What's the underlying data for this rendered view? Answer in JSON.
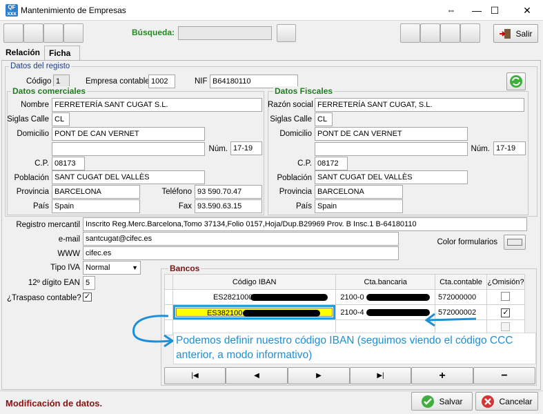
{
  "window": {
    "title": "Mantenimiento de Empresas",
    "minimize": "—",
    "maximize": "☐",
    "close": "✕",
    "restore": "⇔"
  },
  "toolbar": {
    "search_label": "Búsqueda:",
    "search_value": "",
    "exit_label": "Salir"
  },
  "tabs": [
    {
      "label": "Relación"
    },
    {
      "label": "Ficha"
    }
  ],
  "registro": {
    "legend": "Datos del registo",
    "codigo_label": "Código",
    "codigo": "1",
    "empresa_label": "Empresa contable",
    "empresa": "1002",
    "nif_label": "NIF",
    "nif": "B64180110"
  },
  "comerciales": {
    "title": "Datos comerciales",
    "nombre_label": "Nombre",
    "nombre": "FERRETERÍA SANT CUGAT S.L.",
    "siglas_label": "Siglas Calle",
    "siglas": "CL",
    "domicilio_label": "Domicilio",
    "domicilio": "PONT DE CAN VERNET",
    "domicilio2": "",
    "num_label": "Núm.",
    "num": "17-19",
    "cp_label": "C.P.",
    "cp": "08173",
    "poblacion_label": "Población",
    "poblacion": "SANT CUGAT DEL VALLÈS",
    "provincia_label": "Provincia",
    "provincia": "BARCELONA",
    "telefono_label": "Teléfono",
    "telefono": "93 590.70.47",
    "pais_label": "País",
    "pais": "Spain",
    "fax_label": "Fax",
    "fax": "93.590.63.15"
  },
  "fiscales": {
    "title": "Datos Fiscales",
    "razon_label": "Razón social",
    "razon": "FERRETERÍA SANT CUGAT, S.L.",
    "siglas_label": "Siglas Calle",
    "siglas": "CL",
    "domicilio_label": "Domicilio",
    "domicilio": "PONT DE CAN VERNET",
    "domicilio2": "",
    "num_label": "Núm.",
    "num": "17-19",
    "cp_label": "C.P.",
    "cp": "08172",
    "poblacion_label": "Población",
    "poblacion": "SANT CUGAT DEL VALLÈS",
    "provincia_label": "Provincia",
    "provincia": "BARCELONA",
    "pais_label": "País",
    "pais": "Spain"
  },
  "extra": {
    "registro_label": "Registro mercantil",
    "registro": "Inscrito Reg.Merc.Barcelona,Tomo 37134,Folio 0157,Hoja/Dup.B29969 Prov. B Insc.1 B-64180110",
    "email_label": "e-mail",
    "email": "santcugat@cifec.es",
    "www_label": "WWW",
    "www": "cifec.es",
    "color_label": "Color formularios",
    "iva_label": "Tipo IVA",
    "iva": "Normal",
    "ean_label": "12º dígito EAN",
    "ean": "5",
    "traspaso_label": "¿Traspaso contable?",
    "traspaso_mark": "✓"
  },
  "bancos": {
    "title": "Bancos",
    "headers": [
      "Código IBAN",
      "Cta.bancaria",
      "Cta.contable",
      "¿Omisión?"
    ],
    "rows": [
      {
        "iban": "ES2821000",
        "cta": "2100-0",
        "contable": "572000000",
        "omision": ""
      },
      {
        "iban": "ES382100",
        "cta": "2100-4",
        "contable": "572000002",
        "omision": "✓"
      }
    ],
    "nav": [
      "|◀",
      "◀",
      "▶",
      "▶|",
      "+",
      "−"
    ]
  },
  "annotation": {
    "text": "Podemos definir nuestro código IBAN (seguimos viendo el código CCC anterior, a modo informativo)",
    "color": "#1e8fd6"
  },
  "status": {
    "text": "Modificación de datos.",
    "save": "Salvar",
    "cancel": "Cancelar"
  }
}
